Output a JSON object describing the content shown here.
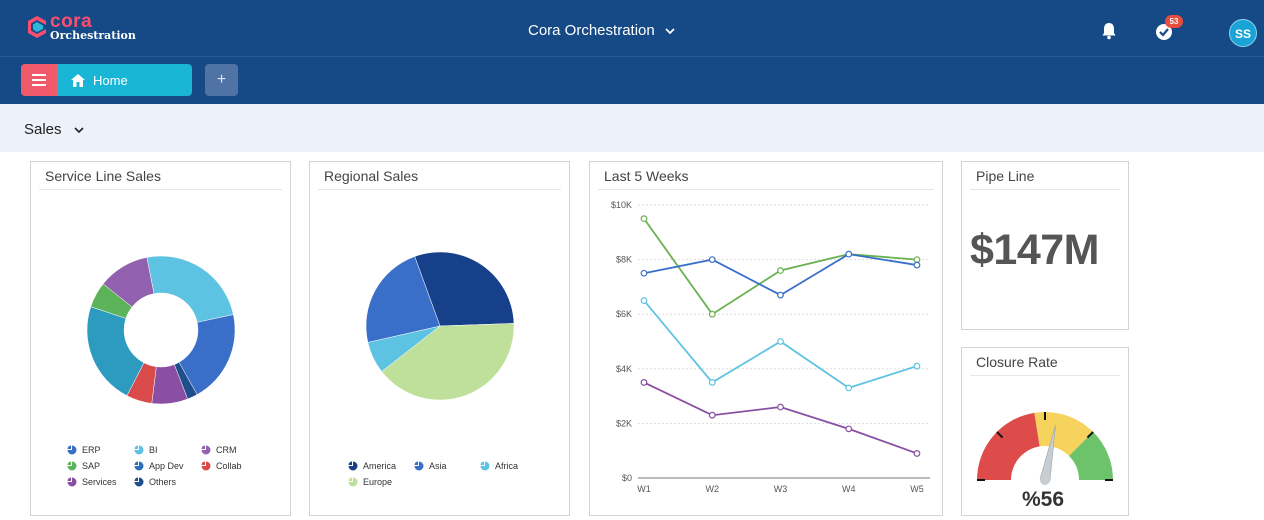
{
  "header": {
    "logo_word": "cora",
    "logo_sub": "Orchestration",
    "app_title": "Cora Orchestration",
    "notification_count": "53",
    "avatar_initials": "SS"
  },
  "tabs": {
    "home_label": "Home",
    "add_label": "+"
  },
  "filter": {
    "selected": "Sales"
  },
  "cards": {
    "service_line": {
      "title": "Service Line Sales",
      "legend": [
        "ERP",
        "BI",
        "CRM",
        "SAP",
        "App Dev",
        "Collab",
        "Services",
        "Others"
      ]
    },
    "regional": {
      "title": "Regional Sales",
      "legend": [
        "America",
        "Asia",
        "Africa",
        "Europe"
      ]
    },
    "weeks": {
      "title": "Last 5 Weeks"
    },
    "pipeline": {
      "title": "Pipe Line",
      "value": "$147M"
    },
    "closure": {
      "title": "Closure Rate",
      "value": "%56"
    }
  },
  "colors": {
    "header_bg": "#154a86",
    "accent_red": "#f05a6a",
    "accent_cyan": "#19b5d6",
    "subbar_bg": "#edf2fa"
  },
  "chart_data": [
    {
      "type": "pie",
      "variant": "donut",
      "categories": [
        "BI",
        "ERP",
        "Others",
        "Services",
        "Collab",
        "CRM",
        "App Dev",
        "SAP"
      ],
      "values": [
        22,
        18,
        2,
        7,
        5,
        20,
        5,
        10
      ],
      "colors": [
        "#5ec3e3",
        "#3a6fc9",
        "#1f4e8c",
        "#8a4fa3",
        "#d94b4b",
        "#2d9ac0",
        "#5db35a",
        "#9160ae"
      ]
    },
    {
      "type": "pie",
      "categories": [
        "America",
        "Europe",
        "Africa",
        "Asia"
      ],
      "values": [
        30,
        40,
        7,
        23
      ],
      "colors": [
        "#17408b",
        "#bfe09a",
        "#5ec3e3",
        "#3a6fc9"
      ]
    },
    {
      "type": "line",
      "categories": [
        "W1",
        "W2",
        "W3",
        "W4",
        "W5"
      ],
      "ylim": [
        0,
        10000
      ],
      "yticks": [
        "$0",
        "$2K",
        "$4K",
        "$6K",
        "$8K",
        "$10K"
      ],
      "series": [
        {
          "values": [
            9500,
            6000,
            7600,
            8200,
            8000
          ],
          "color": "#6ab150"
        },
        {
          "values": [
            7500,
            8000,
            6700,
            8200,
            7800
          ],
          "color": "#3a6fc9"
        },
        {
          "values": [
            6500,
            3500,
            5000,
            3300,
            4100
          ],
          "color": "#5ec3e3"
        },
        {
          "values": [
            3500,
            2300,
            2600,
            1800,
            900
          ],
          "color": "#8a4fa3"
        }
      ]
    },
    {
      "type": "gauge",
      "value": 56,
      "max": 100,
      "bands": [
        {
          "to": 45,
          "color": "#de4b4b"
        },
        {
          "to": 75,
          "color": "#f6d35c"
        },
        {
          "to": 100,
          "color": "#6cc36a"
        }
      ]
    }
  ]
}
